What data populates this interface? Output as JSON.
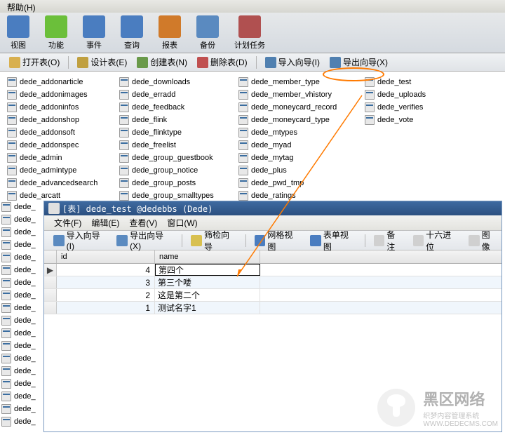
{
  "menu": {
    "help": "帮助(H)"
  },
  "toolbar": [
    {
      "label": "视图",
      "color": "#4a7dc0"
    },
    {
      "label": "功能",
      "color": "#6bbf3a"
    },
    {
      "label": "事件",
      "color": "#4a7dc0"
    },
    {
      "label": "查询",
      "color": "#4a7dc0"
    },
    {
      "label": "报表",
      "color": "#d07a2a"
    },
    {
      "label": "备份",
      "color": "#5a8ac0"
    },
    {
      "label": "计划任务",
      "color": "#b05050"
    }
  ],
  "actions": {
    "open": "打开表(O)",
    "design": "设计表(E)",
    "create": "创建表(N)",
    "delete": "删除表(D)",
    "import_wiz": "导入向导(I)",
    "export_wiz": "导出向导(X)"
  },
  "tables": {
    "col1": [
      "dede_addonarticle",
      "dede_addonimages",
      "dede_addoninfos",
      "dede_addonshop",
      "dede_addonsoft",
      "dede_addonspec",
      "dede_admin",
      "dede_admintype",
      "dede_advancedsearch",
      "dede_arcatt"
    ],
    "col2": [
      "dede_downloads",
      "dede_erradd",
      "dede_feedback",
      "dede_flink",
      "dede_flinktype",
      "dede_freelist",
      "dede_group_guestbook",
      "dede_group_notice",
      "dede_group_posts",
      "dede_group_smalltypes"
    ],
    "col3": [
      "dede_member_type",
      "dede_member_vhistory",
      "dede_moneycard_record",
      "dede_moneycard_type",
      "dede_mtypes",
      "dede_myad",
      "dede_mytag",
      "dede_plus",
      "dede_pwd_tmp",
      "dede_ratings"
    ],
    "col4": [
      "dede_test",
      "dede_uploads",
      "dede_verifies",
      "dede_vote"
    ]
  },
  "left_strip": [
    "dede_",
    "dede_",
    "dede_",
    "dede_",
    "dede_",
    "dede_",
    "dede_",
    "dede_",
    "dede_",
    "dede_",
    "dede_",
    "dede_",
    "dede_",
    "dede_",
    "dede_",
    "dede_",
    "dede_",
    "dede_"
  ],
  "sub": {
    "title": "[表] dede_test @dedebbs (Dede)",
    "menu": {
      "file": "文件(F)",
      "edit": "编辑(E)",
      "view": "查看(V)",
      "window": "窗口(W)"
    },
    "tools": {
      "import": "导入向导(I)",
      "export": "导出向导(X)",
      "filter": "筛检向导",
      "grid_view": "网格视图",
      "form_view": "表单视图",
      "memo": "备注",
      "hex": "十六进位",
      "image": "图像"
    },
    "grid": {
      "headers": {
        "id": "id",
        "name": "name"
      },
      "rows": [
        {
          "id": "4",
          "name": "第四个",
          "current": true
        },
        {
          "id": "3",
          "name": "第三个喽"
        },
        {
          "id": "2",
          "name": "这是第二个"
        },
        {
          "id": "1",
          "name": "测试名字1"
        }
      ]
    }
  },
  "watermark": {
    "line1": "黑区网络",
    "line2": "织梦内容管理系统",
    "line3": "WWW.DEDECMS.COM"
  }
}
